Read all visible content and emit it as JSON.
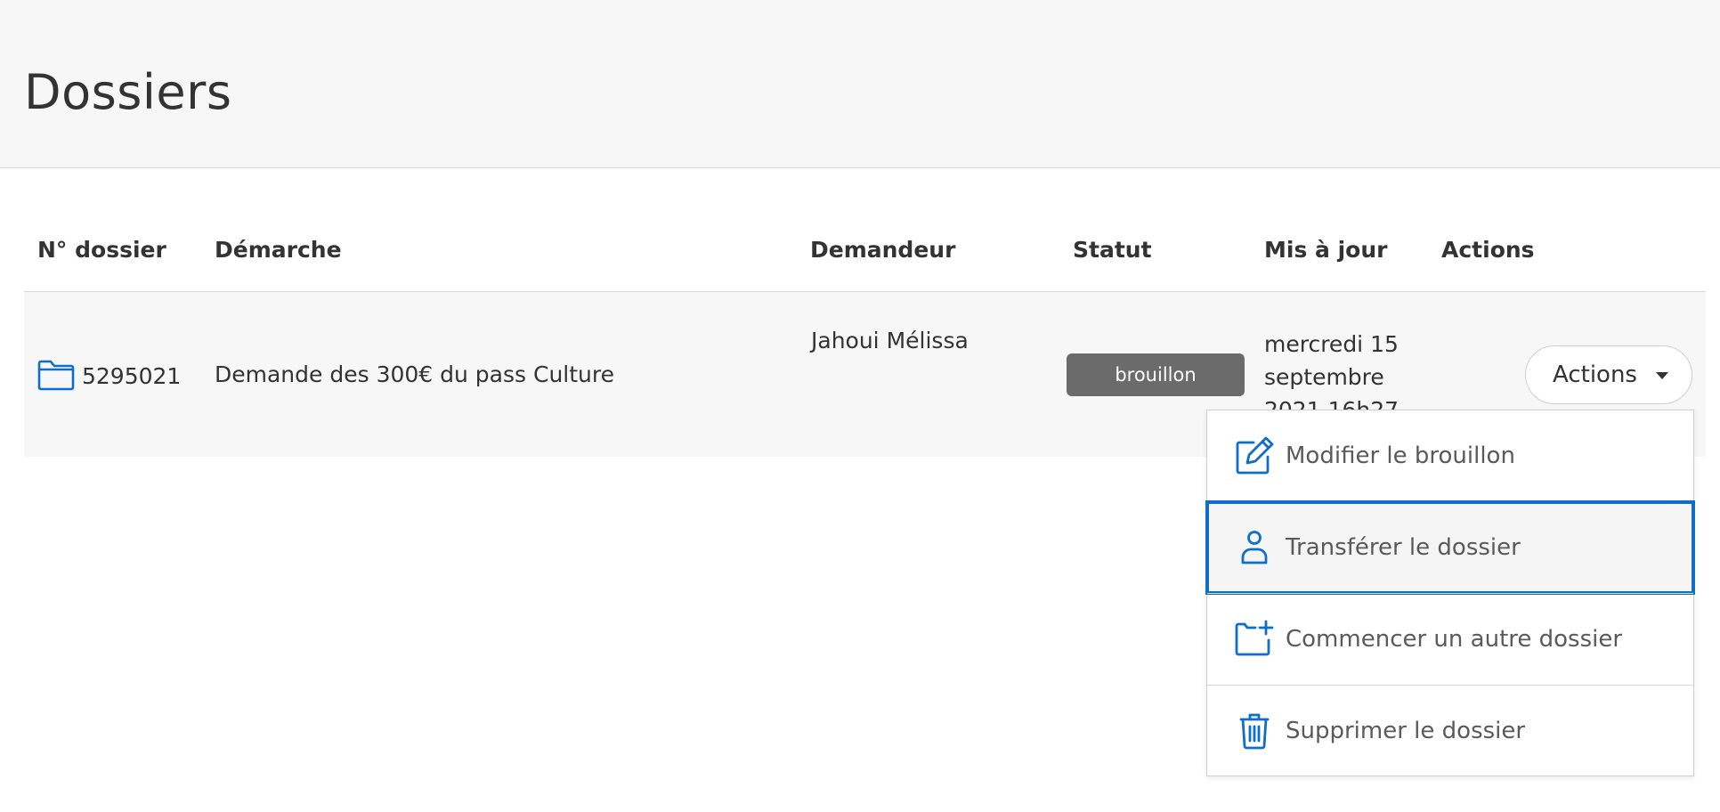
{
  "page": {
    "title": "Dossiers"
  },
  "table": {
    "columns": [
      "N° dossier",
      "Démarche",
      "Demandeur",
      "Statut",
      "Mis à jour",
      "Actions"
    ],
    "rows": [
      {
        "number": "5295021",
        "procedure": "Demande des 300€ du pass Culture",
        "applicant": "Jahoui Mélissa",
        "status": "brouillon",
        "updated": "mercredi 15 septembre 2021 16h27",
        "actions_label": "Actions"
      }
    ]
  },
  "actions_menu": {
    "items": [
      {
        "label": "Modifier le brouillon",
        "icon": "edit-icon"
      },
      {
        "label": "Transférer le dossier",
        "icon": "person-icon"
      },
      {
        "label": "Commencer un autre dossier",
        "icon": "new-folder-icon"
      },
      {
        "label": "Supprimer le dossier",
        "icon": "trash-icon"
      }
    ],
    "focused_index": 1
  },
  "colors": {
    "accent": "#0f6ec8",
    "status_badge": "#6b6b6b",
    "header_bg": "#f7f7f7",
    "text": "#333333"
  }
}
